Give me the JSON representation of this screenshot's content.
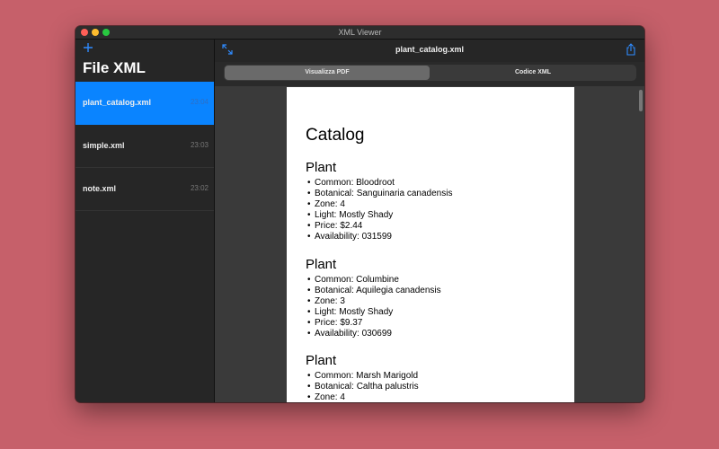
{
  "window": {
    "title": "XML Viewer"
  },
  "sidebar": {
    "title": "File XML",
    "add_icon": "plus-icon",
    "files": [
      {
        "name": "plant_catalog.xml",
        "time": "23:04",
        "selected": true
      },
      {
        "name": "simple.xml",
        "time": "23:03",
        "selected": false
      },
      {
        "name": "note.xml",
        "time": "23:02",
        "selected": false
      }
    ]
  },
  "toolbar": {
    "document_title": "plant_catalog.xml",
    "expand_icon": "expand-arrows-icon",
    "share_icon": "share-icon"
  },
  "tabs": [
    {
      "label": "Visualizza PDF",
      "selected": true
    },
    {
      "label": "Codice XML",
      "selected": false
    }
  ],
  "document": {
    "heading": "Catalog",
    "plants": [
      {
        "heading": "Plant",
        "fields": [
          "Common: Bloodroot",
          "Botanical: Sanguinaria canadensis",
          "Zone: 4",
          "Light: Mostly Shady",
          "Price: $2.44",
          "Availability: 031599"
        ]
      },
      {
        "heading": "Plant",
        "fields": [
          "Common: Columbine",
          "Botanical: Aquilegia canadensis",
          "Zone: 3",
          "Light: Mostly Shady",
          "Price: $9.37",
          "Availability: 030699"
        ]
      },
      {
        "heading": "Plant",
        "fields": [
          "Common: Marsh Marigold",
          "Botanical: Caltha palustris",
          "Zone: 4"
        ]
      }
    ]
  },
  "colors": {
    "desktop": "#c6606a",
    "accent": "#0a84ff",
    "sidebar_bg": "#262626"
  }
}
